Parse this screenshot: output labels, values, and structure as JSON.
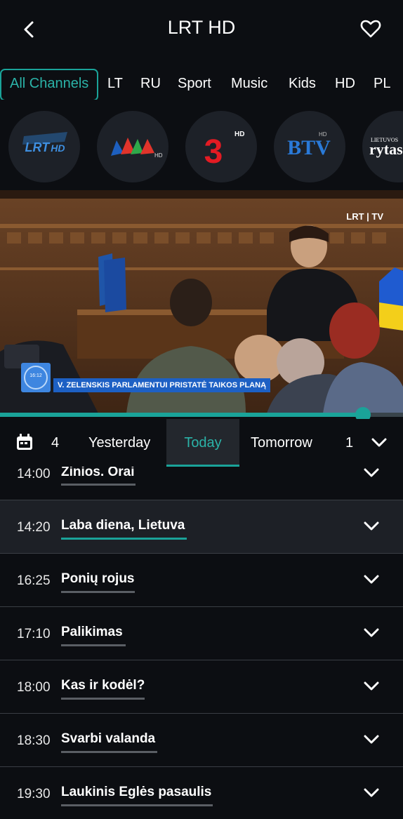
{
  "header": {
    "title": "LRT HD"
  },
  "categories": [
    "All Channels",
    "LT",
    "RU",
    "Sport",
    "Music",
    "Kids",
    "HD",
    "PL"
  ],
  "channels": [
    {
      "name": "LRT HD",
      "logo_text": "LRT",
      "logo_sub": "HD"
    },
    {
      "name": "LNK HD",
      "logo_text": "LNK",
      "logo_sub": "HD"
    },
    {
      "name": "TV3 HD",
      "logo_text": "3",
      "logo_sub": "HD"
    },
    {
      "name": "BTV HD",
      "logo_text": "BTV",
      "logo_sub": "HD"
    },
    {
      "name": "Lietuvos rytas HD",
      "logo_text": "rytas",
      "logo_sub": "LIETUVOS"
    }
  ],
  "player": {
    "watermark": "LRT | TV",
    "clock": "16:12",
    "caption": "V. ZELENSKIS PARLAMENTUI PRISTATĖ TAIKOS PLANĄ",
    "progress": 0.9
  },
  "days": {
    "prev_count": "4",
    "yesterday": "Yesterday",
    "today": "Today",
    "tomorrow": "Tomorrow",
    "next_count": "1"
  },
  "programs": [
    {
      "time": "14:00",
      "title": "Žinios. Orai"
    },
    {
      "time": "14:20",
      "title": "Laba diena, Lietuva",
      "active": true
    },
    {
      "time": "16:25",
      "title": "Ponių rojus"
    },
    {
      "time": "17:10",
      "title": "Palikimas"
    },
    {
      "time": "18:00",
      "title": "Kas ir kodėl?"
    },
    {
      "time": "18:30",
      "title": "Svarbi valanda"
    },
    {
      "time": "19:30",
      "title": "Laukinis Eglės pasaulis"
    }
  ],
  "colors": {
    "accent": "#1aa399",
    "background": "#0c0e12"
  }
}
